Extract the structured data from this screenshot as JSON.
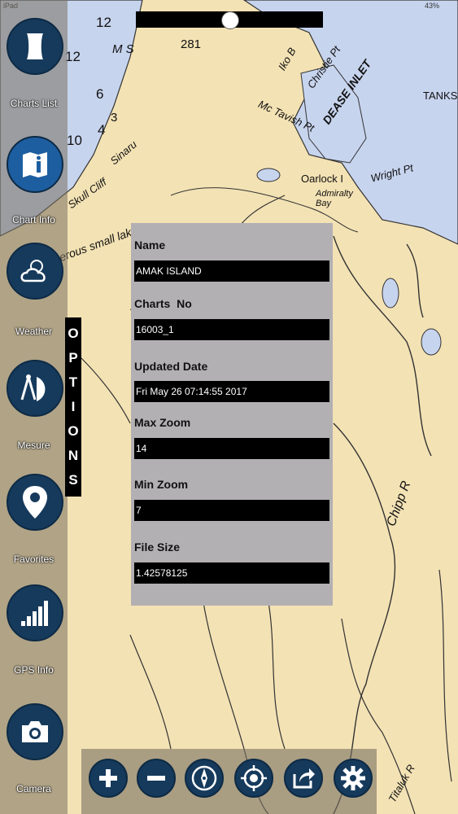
{
  "status_bar": {
    "carrier": "iPad",
    "battery": "43%"
  },
  "sidebar": {
    "items": [
      {
        "label": "Charts List",
        "icon": "scroll-icon"
      },
      {
        "label": "Chart Info",
        "icon": "map-info-icon"
      },
      {
        "label": "Weather",
        "icon": "weather-icon"
      },
      {
        "label": "Mesure",
        "icon": "compass-ruler-icon"
      },
      {
        "label": "Favorites",
        "icon": "location-pin-icon"
      },
      {
        "label": "GPS Info",
        "icon": "signal-bars-icon"
      },
      {
        "label": "Camera",
        "icon": "camera-icon"
      }
    ]
  },
  "options_tab": {
    "letters": [
      "O",
      "P",
      "T",
      "I",
      "O",
      "N",
      "S"
    ]
  },
  "zoom_slider": {
    "level": 0.5
  },
  "chart_info": {
    "name_label": "Name",
    "name_value": "AMAK ISLAND",
    "charts_no_label": "Charts  No",
    "charts_no_value": "16003_1",
    "updated_label": "Updated Date",
    "updated_value": "Fri May 26 07:14:55 2017",
    "max_zoom_label": "Max Zoom",
    "max_zoom_value": "14",
    "min_zoom_label": "Min Zoom",
    "min_zoom_value": "7",
    "file_size_label": "File Size",
    "file_size_value": "1.42578125"
  },
  "map_labels": {
    "dease_inlet": "DEASE INLET",
    "christie_pt": "Christie Pt",
    "mc_tavish_pt": "Mc Tavish Pt",
    "oarlock": "Oarlock I",
    "admiralty_bay": "Admiralty Bay",
    "wright_pt": "Wright Pt",
    "tanks": "TANKS",
    "sinaru": "Sinaru",
    "skull_cliff": "Skull Cliff",
    "chipp_r": "Chipp R",
    "titaluk_r": "Titaluk R",
    "small_lakes": "erous small lakes",
    "iko_b": "Iko B",
    "ms": "M S",
    "num_281": "281",
    "num_12a": "12",
    "num_12b": "12",
    "num_6": "6",
    "num_4": "4",
    "num_10": "10",
    "num_3": "3"
  },
  "colors": {
    "land": "#f3e2b4",
    "water": "#c7d4ee",
    "icon_bg": "#163a5c"
  }
}
